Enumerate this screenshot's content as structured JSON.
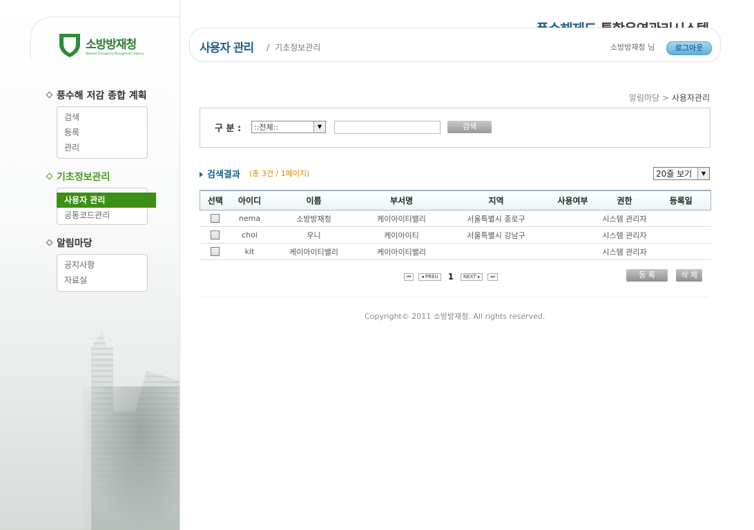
{
  "logo": {
    "name_ko": "소방방재청",
    "name_en": "National Emergency Management Agency"
  },
  "header": {
    "system_title_highlight": "풍수해제도",
    "system_title_rest": "통합운영관리시스템",
    "page_title": "사용자 관리",
    "page_separator": "/",
    "page_subtitle": "기초정보관리",
    "user_name": "소방방재청 님",
    "logout_label": "로그아웃"
  },
  "sidebar": {
    "groups": [
      {
        "title": "풍수해 저감 종합 계획",
        "items": [
          "검색",
          "등록",
          "관리"
        ]
      },
      {
        "title": "기초정보관리",
        "items": [
          "사용자 관리",
          "공통코드관리"
        ]
      },
      {
        "title": "알림마당",
        "items": [
          "공지사항",
          "자료실"
        ]
      }
    ]
  },
  "breadcrumb": {
    "parent": "알림마당",
    "sep": ">",
    "current": "사용자관리"
  },
  "search": {
    "label": "구 분 :",
    "select_value": "::전체::",
    "input_value": "",
    "button_label": "검색"
  },
  "results": {
    "title": "검색결과",
    "count_text": "(총 3건 / 1페이지)",
    "per_page": "20줄 보기",
    "columns": [
      "선택",
      "아이디",
      "이름",
      "부서명",
      "지역",
      "사용여부",
      "권한",
      "등록일"
    ],
    "rows": [
      {
        "id": "nema",
        "name": "소방방재청",
        "dept": "케이아이티밸리",
        "region": "서울특별시 종로구",
        "use": "",
        "role": "시스템 관리자",
        "date": ""
      },
      {
        "id": "choi",
        "name": "우니",
        "dept": "케이아이티",
        "region": "서울특별시 강남구",
        "use": "",
        "role": "시스템 관리자",
        "date": ""
      },
      {
        "id": "kit",
        "name": "케이아이티밸리",
        "dept": "케이아이티밸리",
        "region": "",
        "use": "",
        "role": "시스템 관리자",
        "date": ""
      }
    ]
  },
  "pager": {
    "first": "⏮",
    "prev": "◂ PREU",
    "current": "1",
    "next": "NEXT ▸",
    "last": "⏭"
  },
  "actions": {
    "register": "등 록",
    "delete": "삭 제"
  },
  "footer": {
    "copyright": "Copyright© 2011 소방방재청. All rights reserved."
  },
  "colors": {
    "brand_blue": "#1b5f8c",
    "menu_green": "#3d8f16",
    "count_orange": "#d58b00"
  }
}
